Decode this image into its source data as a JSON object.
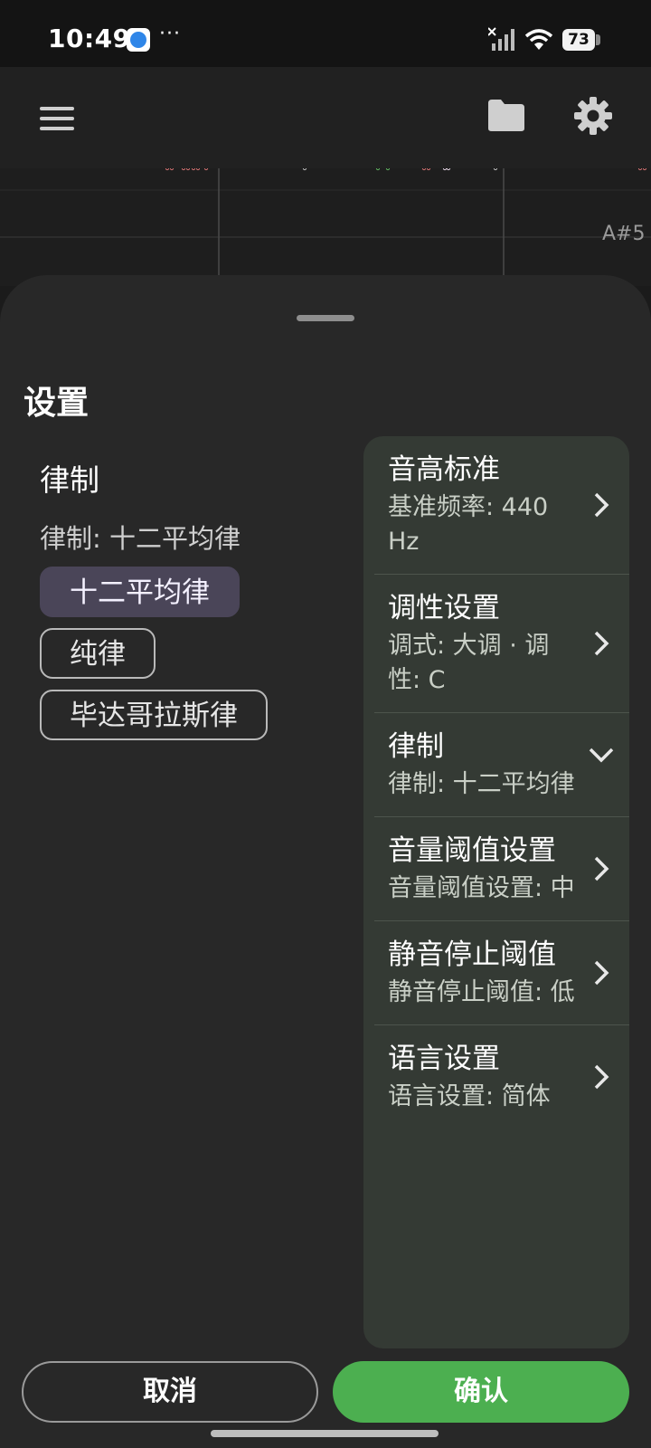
{
  "status_bar": {
    "time": "10:49",
    "more": "···",
    "battery": "73"
  },
  "app_bar": {
    "icons": [
      "menu-icon",
      "folder-icon",
      "gear-icon"
    ]
  },
  "graph": {
    "note_label": "A#5"
  },
  "sheet": {
    "title": "设置",
    "left": {
      "title": "律制",
      "current": "律制: 十二平均律",
      "options": [
        "十二平均律",
        "纯律",
        "毕达哥拉斯律"
      ],
      "selected": "十二平均律"
    },
    "right_items": [
      {
        "title": "音高标准",
        "subtitle": "基准频率: 440 Hz",
        "chevron": "right"
      },
      {
        "title": "调性设置",
        "subtitle": "调式: 大调 · 调性: C",
        "chevron": "right"
      },
      {
        "title": "律制",
        "subtitle": "律制: 十二平均律",
        "chevron": "down"
      },
      {
        "title": "音量阈值设置",
        "subtitle": "音量阈值设置: 中",
        "chevron": "right"
      },
      {
        "title": "静音停止阈值",
        "subtitle": "静音停止阈值: 低",
        "chevron": "right"
      },
      {
        "title": "语言设置",
        "subtitle": "语言设置: 简体",
        "chevron": "right"
      }
    ]
  },
  "footer": {
    "cancel_label": "取消",
    "confirm_label": "确认"
  },
  "colors": {
    "accent_green": "#4caf50",
    "selected_chip": "#4a4558",
    "panel": "#343a34",
    "sheet": "#282828"
  }
}
